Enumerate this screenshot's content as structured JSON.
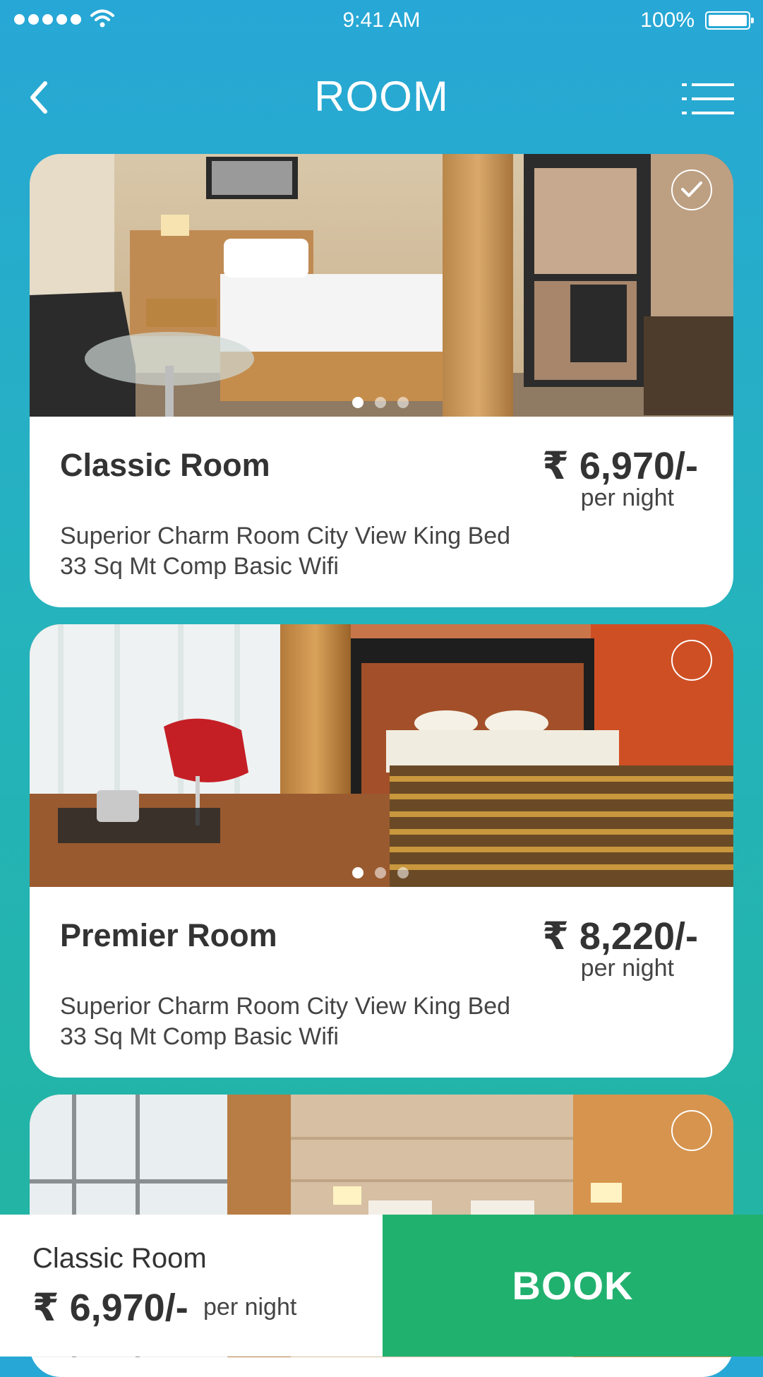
{
  "status_bar": {
    "time": "9:41 AM",
    "battery": "100%",
    "icons": [
      "signal-dots-icon",
      "wifi-icon",
      "battery-icon"
    ]
  },
  "header": {
    "title": "ROOM",
    "back_icon": "chevron-left-icon",
    "menu_icon": "list-menu-icon"
  },
  "rooms": [
    {
      "name": "Classic Room",
      "price": "₹ 6,970/-",
      "per": "per night",
      "desc_line1": "Superior Charm Room City View King Bed",
      "desc_line2": "33 Sq Mt Comp Basic Wifi",
      "selected": true,
      "carousel_index": 1,
      "carousel_count": 3
    },
    {
      "name": "Premier Room",
      "price": "₹ 8,220/-",
      "per": "per night",
      "desc_line1": "Superior Charm Room City View King Bed",
      "desc_line2": "33 Sq Mt Comp Basic Wifi",
      "selected": false,
      "carousel_index": 1,
      "carousel_count": 3
    },
    {
      "selected": false
    }
  ],
  "footer": {
    "selected_name": "Classic Room",
    "selected_price": "₹ 6,970/-",
    "selected_per": "per night",
    "book_label": "BOOK"
  },
  "colors": {
    "gradient_top": "#27a7d6",
    "gradient_bottom": "#22b49e",
    "book_green": "#21b16f",
    "text_dark": "#333333"
  }
}
